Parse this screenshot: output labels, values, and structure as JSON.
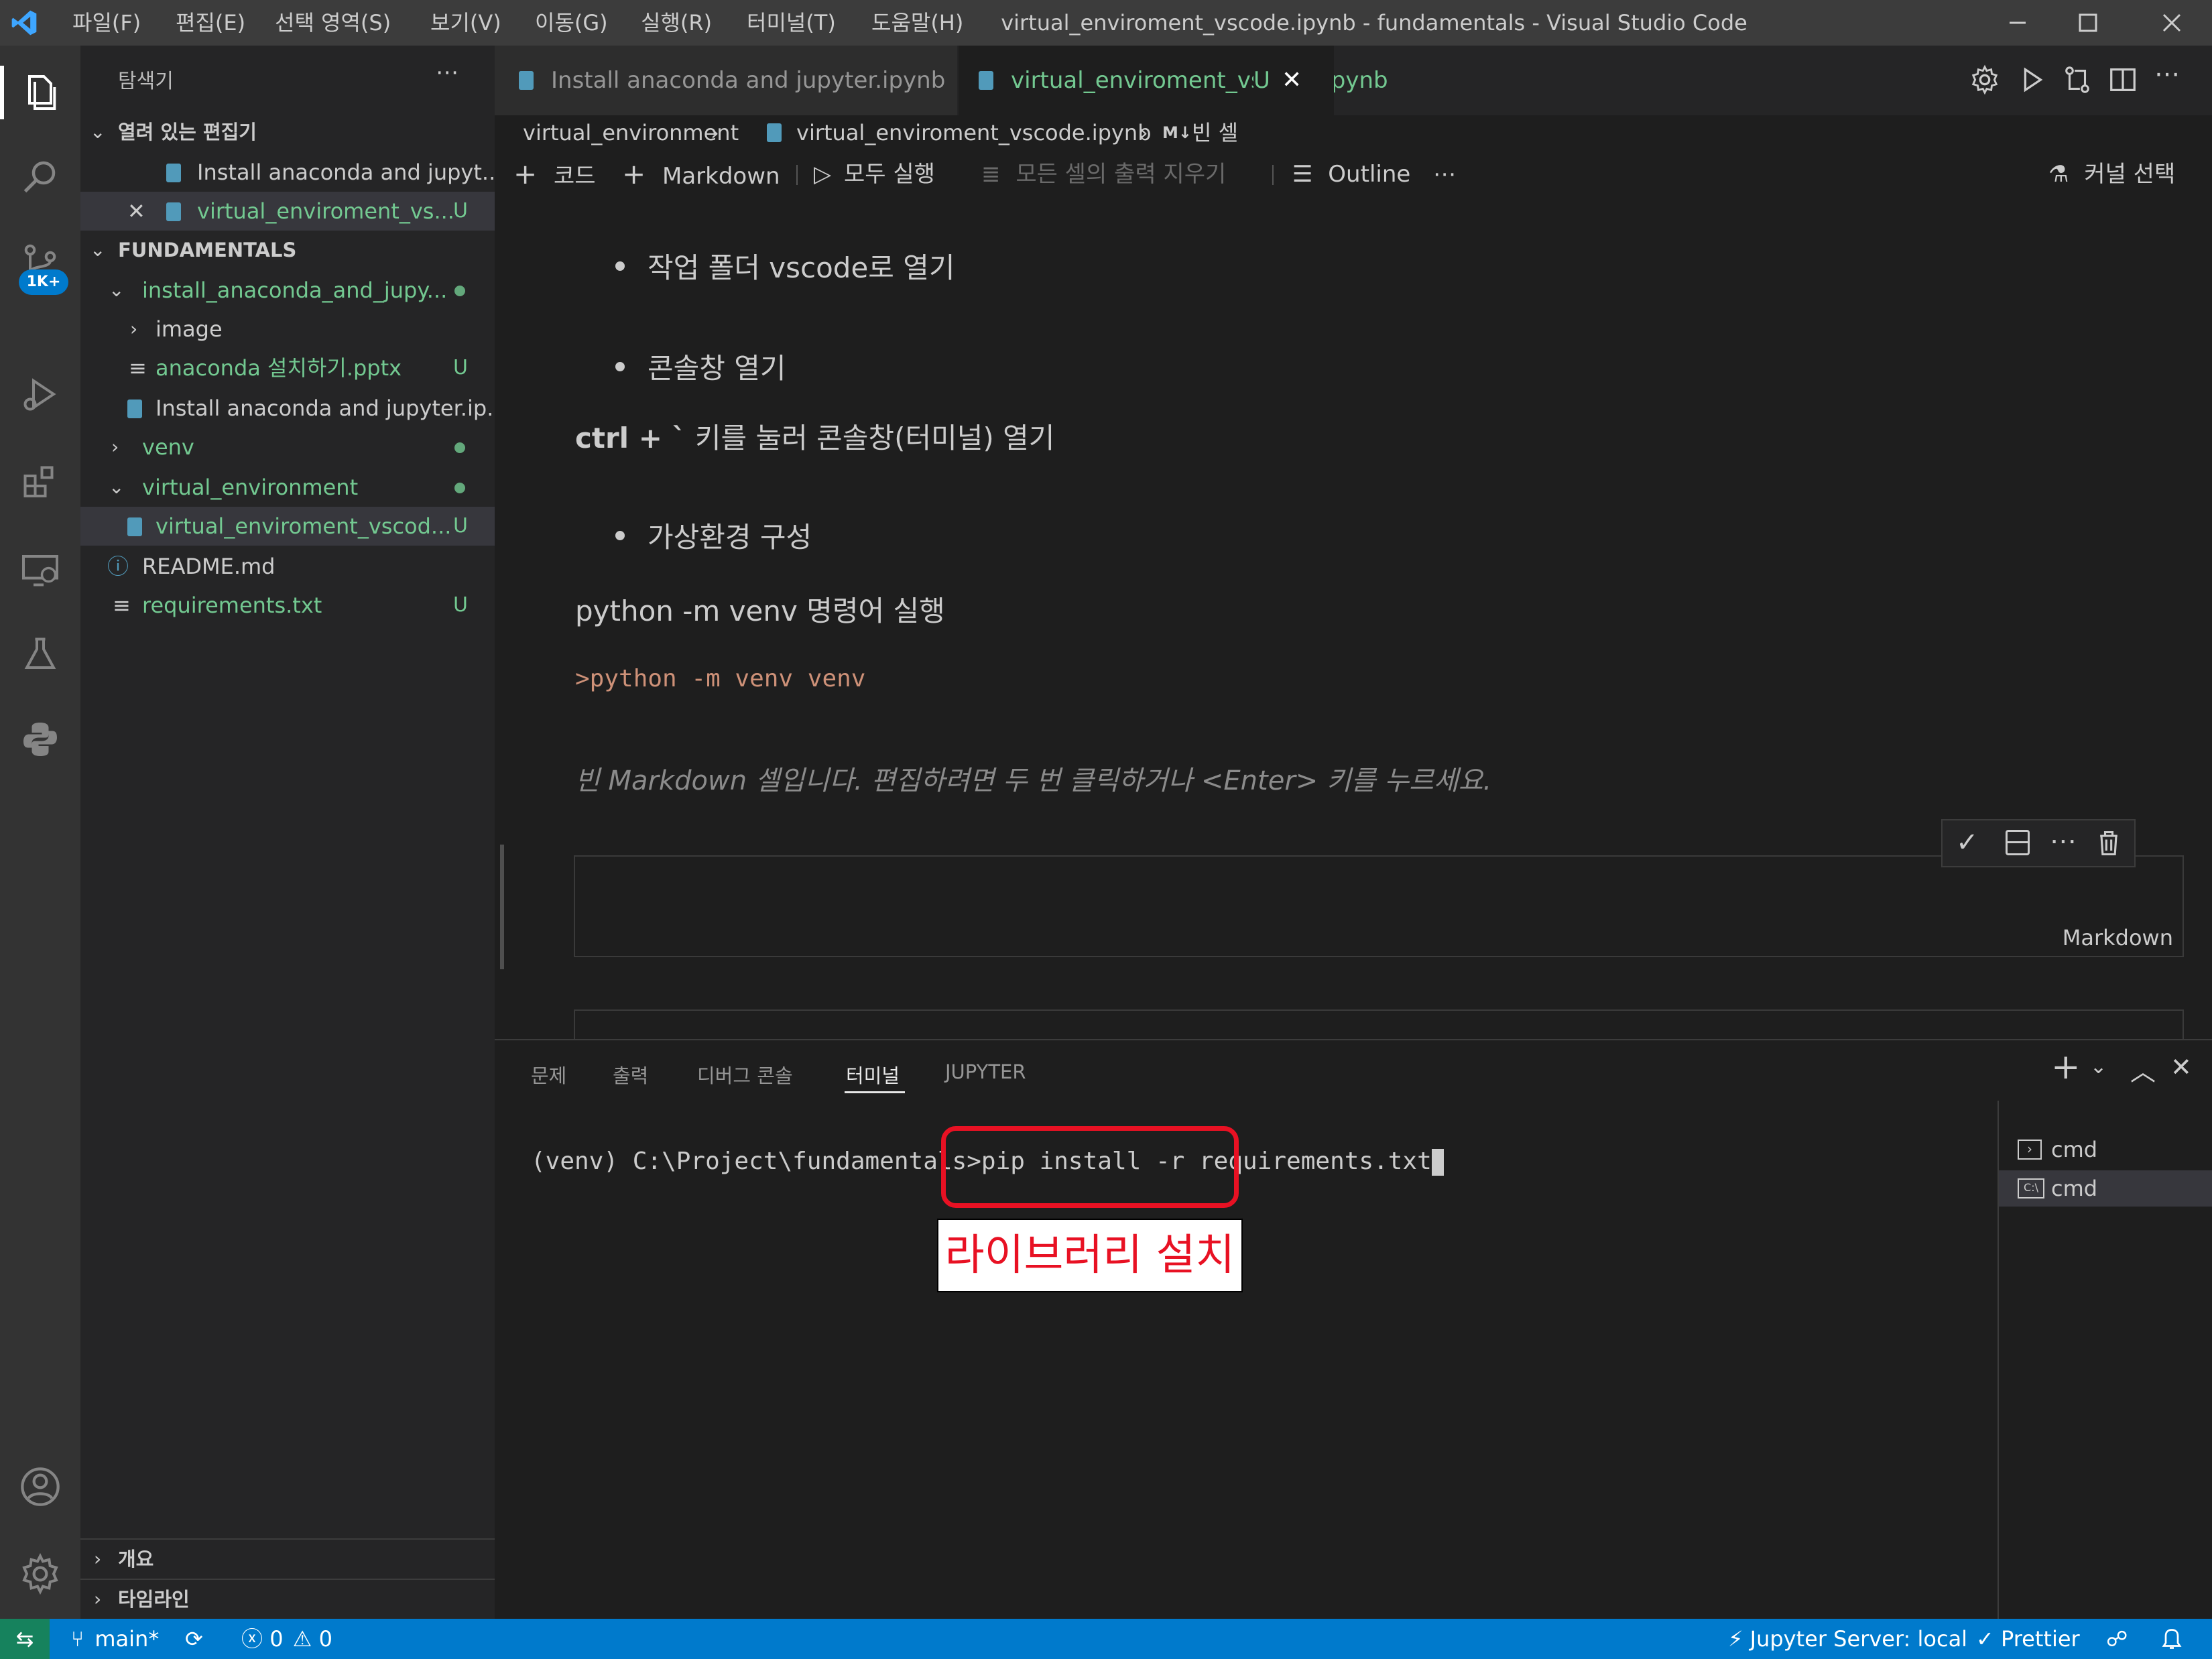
{
  "titlebar": {
    "menus": [
      "파일(F)",
      "편집(E)",
      "선택 영역(S)",
      "보기(V)",
      "이동(G)",
      "실행(R)",
      "터미널(T)",
      "도움말(H)"
    ],
    "title": "virtual_enviroment_vscode.ipynb - fundamentals - Visual Studio Code"
  },
  "activity": {
    "scm_badge": "1K+"
  },
  "sidebar": {
    "title": "탐색기",
    "open_editors": {
      "label": "열려 있는 편집기",
      "items": [
        "Install anaconda and jupyt...",
        "virtual_enviroment_vs..."
      ],
      "badge": "U"
    },
    "folder": {
      "label": "FUNDAMENTALS",
      "items": [
        {
          "label": "install_anaconda_and_jupy...",
          "status": ""
        },
        {
          "label": "image",
          "status": ""
        },
        {
          "label": "anaconda 설치하기.pptx",
          "status": "U"
        },
        {
          "label": "Install anaconda and jupyter.ip...",
          "status": ""
        },
        {
          "label": "venv",
          "status": ""
        },
        {
          "label": "virtual_environment",
          "status": ""
        },
        {
          "label": "virtual_enviroment_vscod...",
          "status": "U"
        },
        {
          "label": "README.md",
          "status": ""
        },
        {
          "label": "requirements.txt",
          "status": "U"
        }
      ]
    },
    "outline": "개요",
    "timeline": "타임라인"
  },
  "tabs": [
    {
      "label": "Install anaconda and jupyter.ipynb"
    },
    {
      "label": "virtual_enviroment_vscode.ipynb",
      "badge": "U"
    }
  ],
  "breadcrumb": {
    "folder": "virtual_environment",
    "file": "virtual_enviroment_vscode.ipynb",
    "cell_icon": "M↓",
    "cell": "빈 셀"
  },
  "toolbar": {
    "code": "코드",
    "markdown": "Markdown",
    "run_all": "모두 실행",
    "clear_outputs": "모든 셀의 출력 지우기",
    "outline": "Outline",
    "kernel": "커널 선택"
  },
  "notebook": {
    "bullet1": "작업 폴더 vscode로 열기",
    "bullet2": "콘솔창 열기",
    "line1_bold": "ctrl + `",
    "line1_rest": " 키를 눌러 콘솔창(터미널) 열기",
    "bullet3": "가상환경 구성",
    "line2": "python -m venv 명령어 실행",
    "code": ">python -m venv venv",
    "empty_md": "빈 Markdown 셀입니다. 편집하려면 두 번 클릭하거나 <Enter> 키를 누르세요.",
    "cell_lang": "Markdown"
  },
  "panel": {
    "tabs": [
      "문제",
      "출력",
      "디버그 콘솔",
      "터미널",
      "JUPYTER"
    ],
    "active_tab": "터미널",
    "prompt": "(venv) C:\\Project\\fundamentals",
    "command": ">pip install -r requirements.txt",
    "annotation": "라이브러리 설치",
    "terminals": [
      "cmd",
      "cmd"
    ]
  },
  "statusbar": {
    "branch": "main*",
    "errors": "0",
    "warnings": "0",
    "jupyter": "Jupyter Server: local",
    "prettier": "Prettier"
  },
  "colors": {
    "accent": "#007acc",
    "untracked": "#73c991",
    "annotation": "#e81123"
  }
}
